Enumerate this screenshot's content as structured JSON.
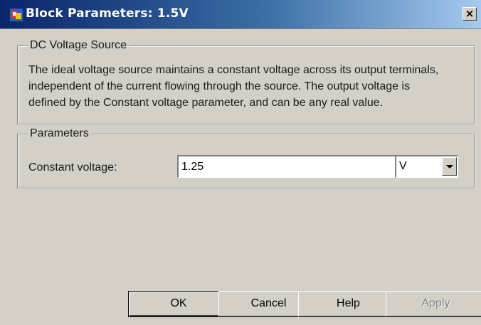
{
  "window": {
    "title": "Block Parameters: 1.5V",
    "close_glyph": "×"
  },
  "description_group": {
    "label": "DC Voltage Source",
    "text_lines": [
      "The ideal voltage source maintains a constant voltage across its output terminals,",
      "independent of the current flowing through the source. The output voltage is",
      "defined by the Constant voltage parameter, and can be any real value."
    ]
  },
  "parameters_group": {
    "label": "Parameters",
    "constant_voltage": {
      "label": "Constant voltage:",
      "value": "1.25",
      "unit": "V"
    }
  },
  "buttons": {
    "ok": "OK",
    "cancel": "Cancel",
    "help": "Help",
    "apply": "Apply",
    "apply_enabled": false
  },
  "colors": {
    "dialog_bg": "#d4d0c8",
    "titlebar_start": "#0a246a",
    "titlebar_end": "#a6caf0"
  }
}
